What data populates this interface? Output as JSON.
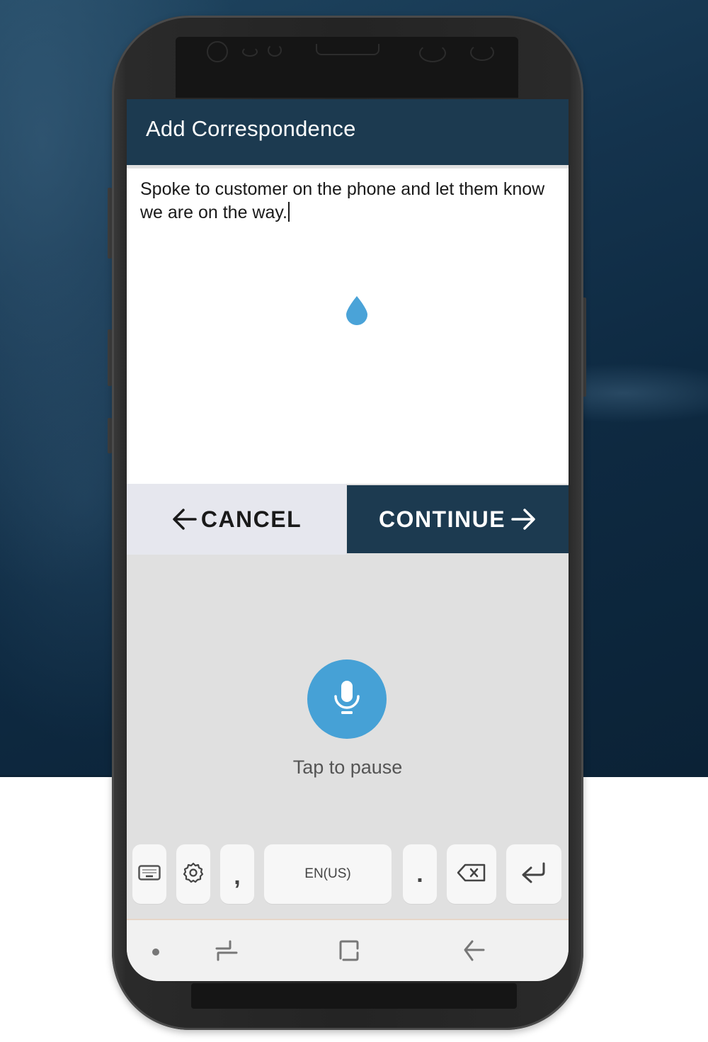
{
  "app": {
    "title": "Add Correspondence"
  },
  "note": {
    "text": "Spoke to customer on the phone and let them know we are on the way."
  },
  "actions": {
    "cancel_label": "CANCEL",
    "continue_label": "CONTINUE"
  },
  "voice_input": {
    "status_label": "Tap to pause",
    "icon": "microphone-icon"
  },
  "keyboard": {
    "keys": [
      {
        "name": "keyboard-switch",
        "icon": "keyboard-icon",
        "label": ""
      },
      {
        "name": "settings",
        "icon": "gear-icon",
        "label": ""
      },
      {
        "name": "comma",
        "label": ","
      },
      {
        "name": "language",
        "label": "EN(US)"
      },
      {
        "name": "period",
        "label": "."
      },
      {
        "name": "backspace",
        "icon": "backspace-icon",
        "label": ""
      },
      {
        "name": "enter",
        "icon": "enter-icon",
        "label": ""
      }
    ]
  },
  "nav_bar": {
    "items": [
      "dot-indicator",
      "recent-apps",
      "home",
      "back"
    ]
  },
  "colors": {
    "header": "#1c3a50",
    "continue_button": "#1c3a50",
    "cancel_button": "#e6e7ee",
    "mic_accent": "#46a1d6",
    "voice_area_bg": "#e0e0e0"
  }
}
